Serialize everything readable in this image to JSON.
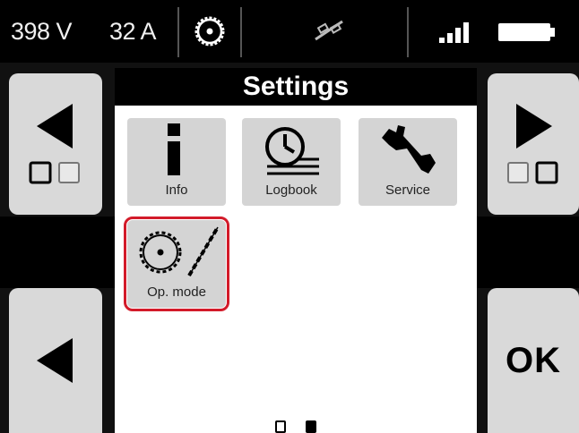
{
  "status": {
    "voltage": "398 V",
    "current": "32 A",
    "gear_icon": "cog-icon",
    "link_icon": "link-icon",
    "signal_icon": "signal-bars-icon",
    "battery_icon": "battery-icon"
  },
  "header": {
    "title": "Settings"
  },
  "tiles": [
    {
      "label": "Info",
      "icon": "info-icon"
    },
    {
      "label": "Logbook",
      "icon": "logbook-icon"
    },
    {
      "label": "Service",
      "icon": "wrench-icon"
    },
    {
      "label": "Op. mode",
      "icon": "op-mode-icon",
      "selected": true
    }
  ],
  "buttons": {
    "ok_label": "OK",
    "prev_page": "arrow-left-icon",
    "next_page": "arrow-right-icon",
    "back": "arrow-left-icon"
  },
  "pagination": {
    "pages": 2,
    "current": 2
  },
  "colors": {
    "accent": "#d31b2a",
    "tile_bg": "#d4d4d4",
    "panel_bg": "#d9d9d9"
  }
}
